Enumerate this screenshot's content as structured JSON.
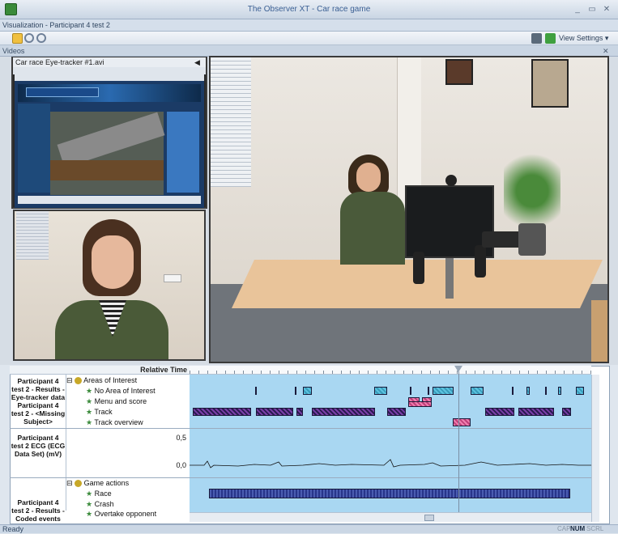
{
  "window": {
    "title": "The Observer XT - Car race game",
    "min": "_",
    "restore": "▭",
    "close": "✕"
  },
  "panel": {
    "title": "Visualization - Participant 4 test 2"
  },
  "toolbar": {
    "view_settings": "View Settings",
    "view_settings_arrow": "▾"
  },
  "videos": {
    "header": "Videos",
    "close": "✕",
    "video1_title": "Car race Eye-tracker #1.avi",
    "speaker": "◀"
  },
  "timeline": {
    "relative_time": "Relative Time",
    "section1": {
      "label": "Participant 4 test 2 - Results - Eye-tracker data Participant 4 test 2 - <Missing Subject>",
      "group": "Areas of Interest",
      "rows": [
        "No Area of Interest",
        "Menu and score",
        "Track",
        "Track overview"
      ]
    },
    "section2": {
      "label": "Participant 4 test 2 ECG (ECG Data Set) (mV)",
      "y_top": "0,5",
      "y_zero": "0,0"
    },
    "section3": {
      "label": "Participant 4 test 2 - Results - Coded events",
      "group": "Game actions",
      "rows": [
        "Race",
        "Crash",
        "Overtake opponent"
      ]
    },
    "expand_icon": "⊟"
  },
  "status": {
    "left": "Ready",
    "cap": "CAP",
    "num": "NUM",
    "scrl": "SCRL"
  },
  "colors": {
    "accent": "#3a5f93",
    "aoi_cyan": "#5cc4e0",
    "aoi_purple": "#7a3fa8",
    "aoi_pink": "#f080b0",
    "race_blue": "#4a5cb0",
    "plot_bg": "#a9d7f2"
  }
}
